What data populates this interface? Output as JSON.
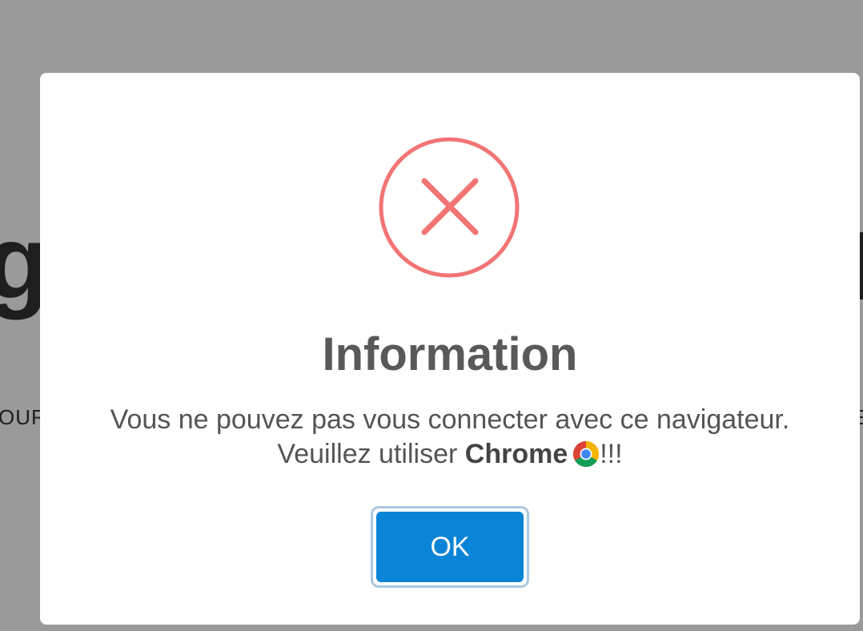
{
  "background": {
    "left_text": "OUR",
    "right_text": "E"
  },
  "dialog": {
    "icon": "error-x-icon",
    "icon_color": "#f27474",
    "title": "Information",
    "message_line1": "Vous ne pouvez pas vous connecter avec ce navigateur.",
    "message_line2_prefix": "Veuillez utiliser",
    "message_line2_bold": "Chrome",
    "message_line2_icon": "chrome-icon",
    "message_line2_suffix": "!!!",
    "ok_label": "OK",
    "ok_color": "#0a84d6"
  }
}
